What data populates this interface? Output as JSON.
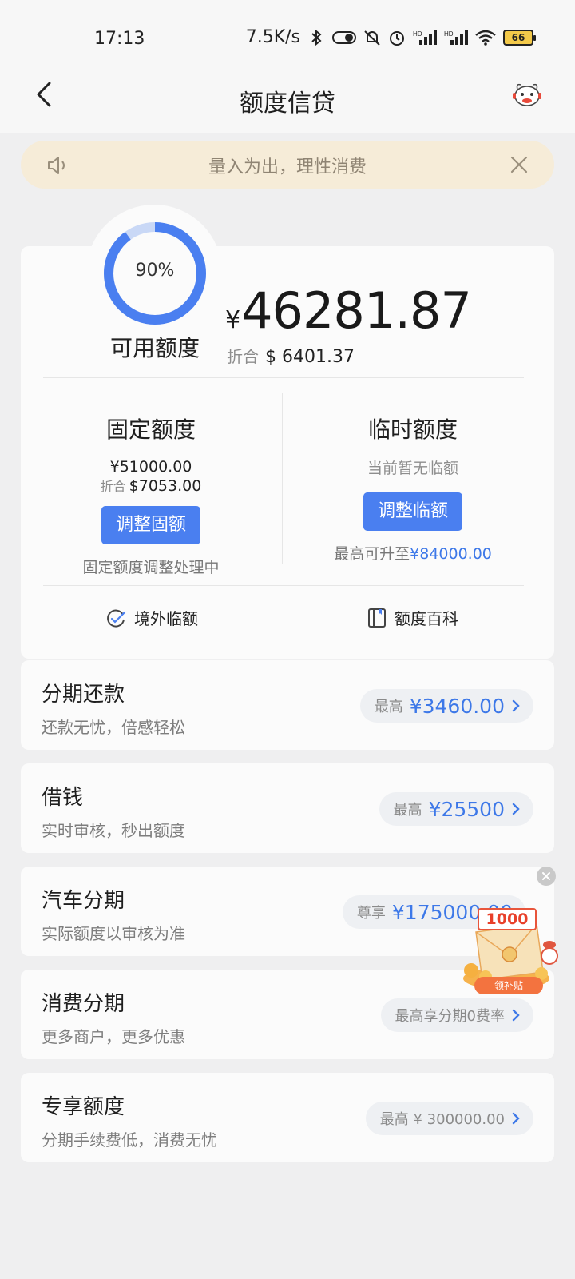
{
  "status_bar": {
    "time": "17:13",
    "speed": "7.5K/s",
    "battery": "66",
    "icons": [
      "bluetooth-icon",
      "toggle-icon",
      "mute-icon",
      "alarm-icon",
      "hd-signal-icon",
      "hd-signal-icon",
      "wifi-icon",
      "battery-icon"
    ]
  },
  "nav": {
    "title": "额度信贷",
    "back_icon": "chevron-left-icon",
    "mascot_icon": "mascot-icon"
  },
  "notice": {
    "text": "量入为出，理性消费",
    "speaker_icon": "speaker-icon",
    "close_icon": "close-icon",
    "bg_color": "#f6ecd8"
  },
  "credit": {
    "percent_label": "90%",
    "percent_value": 0.9,
    "label": "可用额度",
    "currency": "¥",
    "amount": "46281.87",
    "equiv_label": "折合",
    "equiv_value": "$ 6401.37",
    "accent": "#4a7ff0"
  },
  "fixed": {
    "title": "固定额度",
    "amount": "¥51000.00",
    "equiv_label": "折合",
    "equiv_value": "$7053.00",
    "button": "调整固额",
    "note": "固定额度调整处理中"
  },
  "temp": {
    "title": "临时额度",
    "status": "当前暂无临额",
    "button": "调整临额",
    "note_prefix": "最高可升至",
    "note_value": "¥84000.00"
  },
  "links": [
    {
      "label": "境外临额",
      "icon": "overseas-refresh-icon"
    },
    {
      "label": "额度百科",
      "icon": "book-icon"
    }
  ],
  "rows": [
    {
      "title": "分期还款",
      "subtitle": "还款无忧，倍感轻松",
      "pill_label": "最高",
      "pill_value": "¥3460.00"
    },
    {
      "title": "借钱",
      "subtitle": "实时审核，秒出额度",
      "pill_label": "最高",
      "pill_value": "¥25500"
    },
    {
      "title": "汽车分期",
      "subtitle": "实际额度以审核为准",
      "pill_label": "尊享",
      "pill_value": "¥175000.00"
    },
    {
      "title": "消费分期",
      "subtitle": "更多商户，更多优惠",
      "pill_label": "",
      "pill_value": "最高享分期0费率"
    },
    {
      "title": "专享额度",
      "subtitle": "分期手续费低，消费无忧",
      "pill_label": "",
      "pill_value": "最高 ¥ 300000.00"
    }
  ],
  "promo": {
    "amount": "1000",
    "tag": "领补贴",
    "icon": "red-envelope-icon"
  }
}
